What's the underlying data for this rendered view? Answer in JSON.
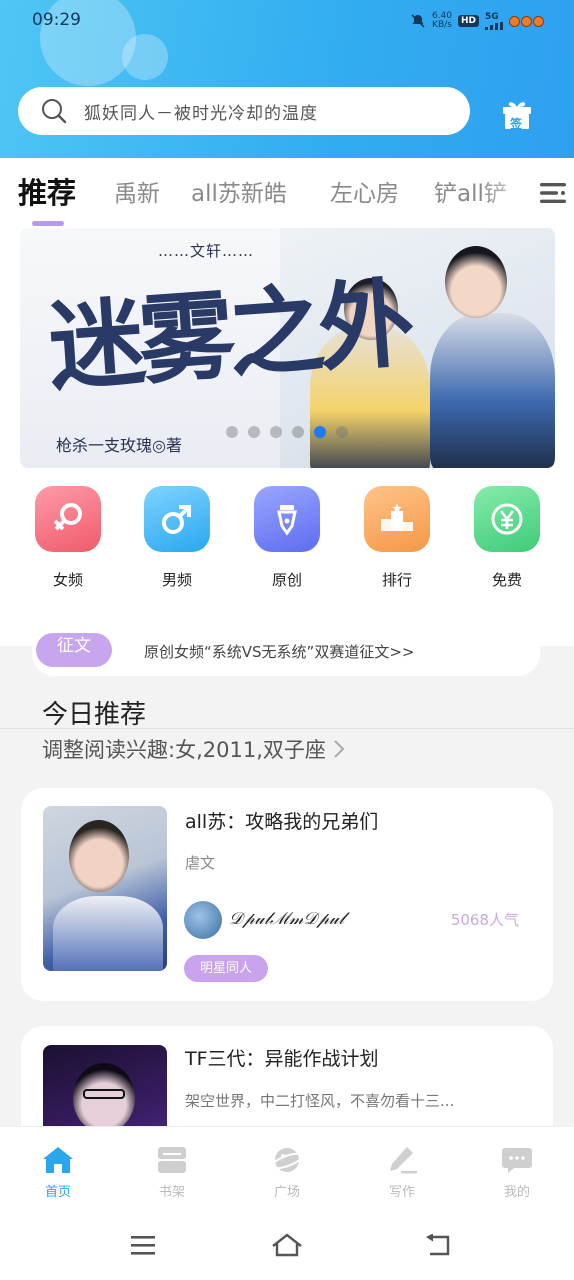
{
  "status_bar": {
    "time": "09:29",
    "speed_value": "6.40",
    "speed_unit": "KB/s",
    "hd": "HD",
    "network": "5G"
  },
  "search": {
    "placeholder": "狐妖同人－被时光冷却的温度"
  },
  "checkin": {
    "label": "签"
  },
  "tabs": [
    {
      "label": "推荐",
      "active": true
    },
    {
      "label": "禹新"
    },
    {
      "label": "all苏新皓"
    },
    {
      "label": "左心房"
    },
    {
      "label": "铲all铲"
    }
  ],
  "banner": {
    "series": "文轩",
    "title": "迷雾之外",
    "author": "枪杀一支玫瑰◎著",
    "slides": 6,
    "active_slide": 4
  },
  "categories": [
    {
      "label": "女频",
      "icon": "female-icon",
      "color": "#f2707c"
    },
    {
      "label": "男频",
      "icon": "male-icon",
      "color": "#38b4f2"
    },
    {
      "label": "原创",
      "icon": "pen-icon",
      "color": "#6f7ef2"
    },
    {
      "label": "排行",
      "icon": "ranking-icon",
      "color": "#f6a45e"
    },
    {
      "label": "免费",
      "icon": "free-icon",
      "color": "#55d08a"
    }
  ],
  "notice": {
    "badge": "征文",
    "text": "原创女频“系统VS无系统”双赛道征文>>"
  },
  "section": {
    "title": "今日推荐",
    "interest": "调整阅读兴趣:女,2011,双子座"
  },
  "books": [
    {
      "title": "all苏：攻略我的兄弟们",
      "tag": "虐文",
      "author": "𝒟𝓅𝓊𝓁ℳ𝓂𝒟𝓅𝓊𝓁",
      "popularity": "5068人气",
      "badge": "明星同人"
    },
    {
      "title": "TF三代：异能作战计划",
      "desc": "架空世界，中二打怪风，不喜勿看十三..."
    }
  ],
  "bottom_nav": [
    {
      "label": "首页",
      "icon": "home-icon",
      "active": true
    },
    {
      "label": "书架",
      "icon": "bookshelf-icon"
    },
    {
      "label": "广场",
      "icon": "planet-icon"
    },
    {
      "label": "写作",
      "icon": "write-icon"
    },
    {
      "label": "我的",
      "icon": "profile-icon"
    }
  ],
  "colors": {
    "accent_blue": "#2aa6ee",
    "accent_purple": "#c9a3ee"
  }
}
